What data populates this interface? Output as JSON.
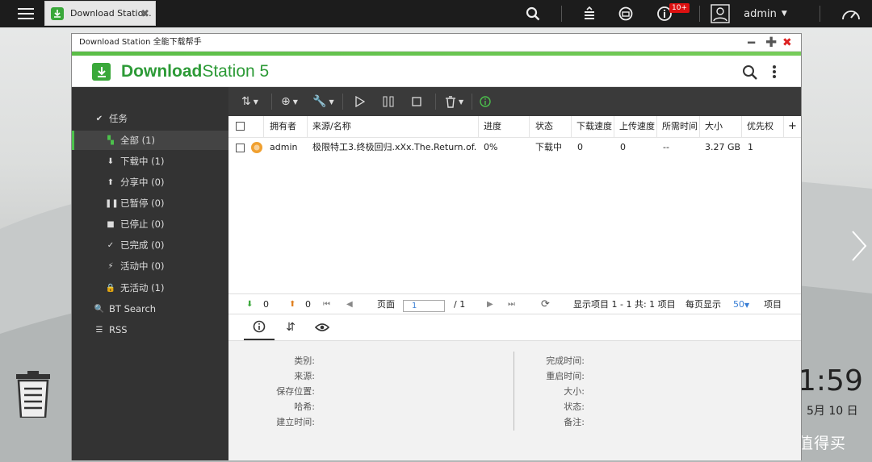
{
  "taskbar": {
    "tab_title": "Download Statio...",
    "notification_badge": "10+",
    "user": "admin"
  },
  "window": {
    "title": "Download Station 全能下载帮手"
  },
  "app": {
    "brand_bold": "Download",
    "brand_light": "Station 5"
  },
  "sidebar": {
    "section_label": "任务",
    "items": [
      {
        "label": "全部 (1)",
        "icon": "grid-icon"
      },
      {
        "label": "下载中 (1)",
        "icon": "download-arrow-icon"
      },
      {
        "label": "分享中 (0)",
        "icon": "upload-arrow-icon"
      },
      {
        "label": "已暂停 (0)",
        "icon": "pause-icon"
      },
      {
        "label": "已停止 (0)",
        "icon": "stop-icon"
      },
      {
        "label": "已完成 (0)",
        "icon": "check-icon"
      },
      {
        "label": "活动中 (0)",
        "icon": "lightning-icon"
      },
      {
        "label": "无活动 (1)",
        "icon": "lock-icon"
      }
    ],
    "bt_search": "BT Search",
    "rss": "RSS"
  },
  "table": {
    "columns": [
      "拥有者",
      "来源/名称",
      "进度",
      "状态",
      "下载速度",
      "上传速度",
      "所需时间",
      "大小",
      "优先权"
    ],
    "rows": [
      {
        "owner": "admin",
        "name": "极限特工3.终极回归.xXx.The.Return.of.X...",
        "progress": "0%",
        "status": "下载中",
        "down_speed": "0",
        "up_speed": "0",
        "eta": "--",
        "size": "3.27 GB",
        "priority": "1"
      }
    ]
  },
  "pager": {
    "download_count": "0",
    "upload_count": "0",
    "page_label": "页面",
    "page_value": "1",
    "page_total": "/ 1",
    "display_info": "显示项目 1 - 1 共: 1 项目",
    "per_page_label": "每页显示",
    "per_page_value": "50",
    "items_label": "项目"
  },
  "details": {
    "left_labels": [
      "类别:",
      "来源:",
      "保存位置:",
      "哈希:",
      "建立时间:"
    ],
    "right_labels": [
      "完成时间:",
      "重启时间:",
      "大小:",
      "状态:",
      "备注:"
    ]
  },
  "desktop": {
    "clock": "1:59",
    "date": "，5月 10 日",
    "watermark": "什么值得买"
  },
  "colors": {
    "accent_green": "#3aa83a",
    "sidebar_bg": "#333333",
    "toolbar_bg": "#3a3a3a",
    "topbar_bg": "#1c1c1c",
    "badge_red": "#dd1111",
    "link_blue": "#3a7fd5"
  }
}
